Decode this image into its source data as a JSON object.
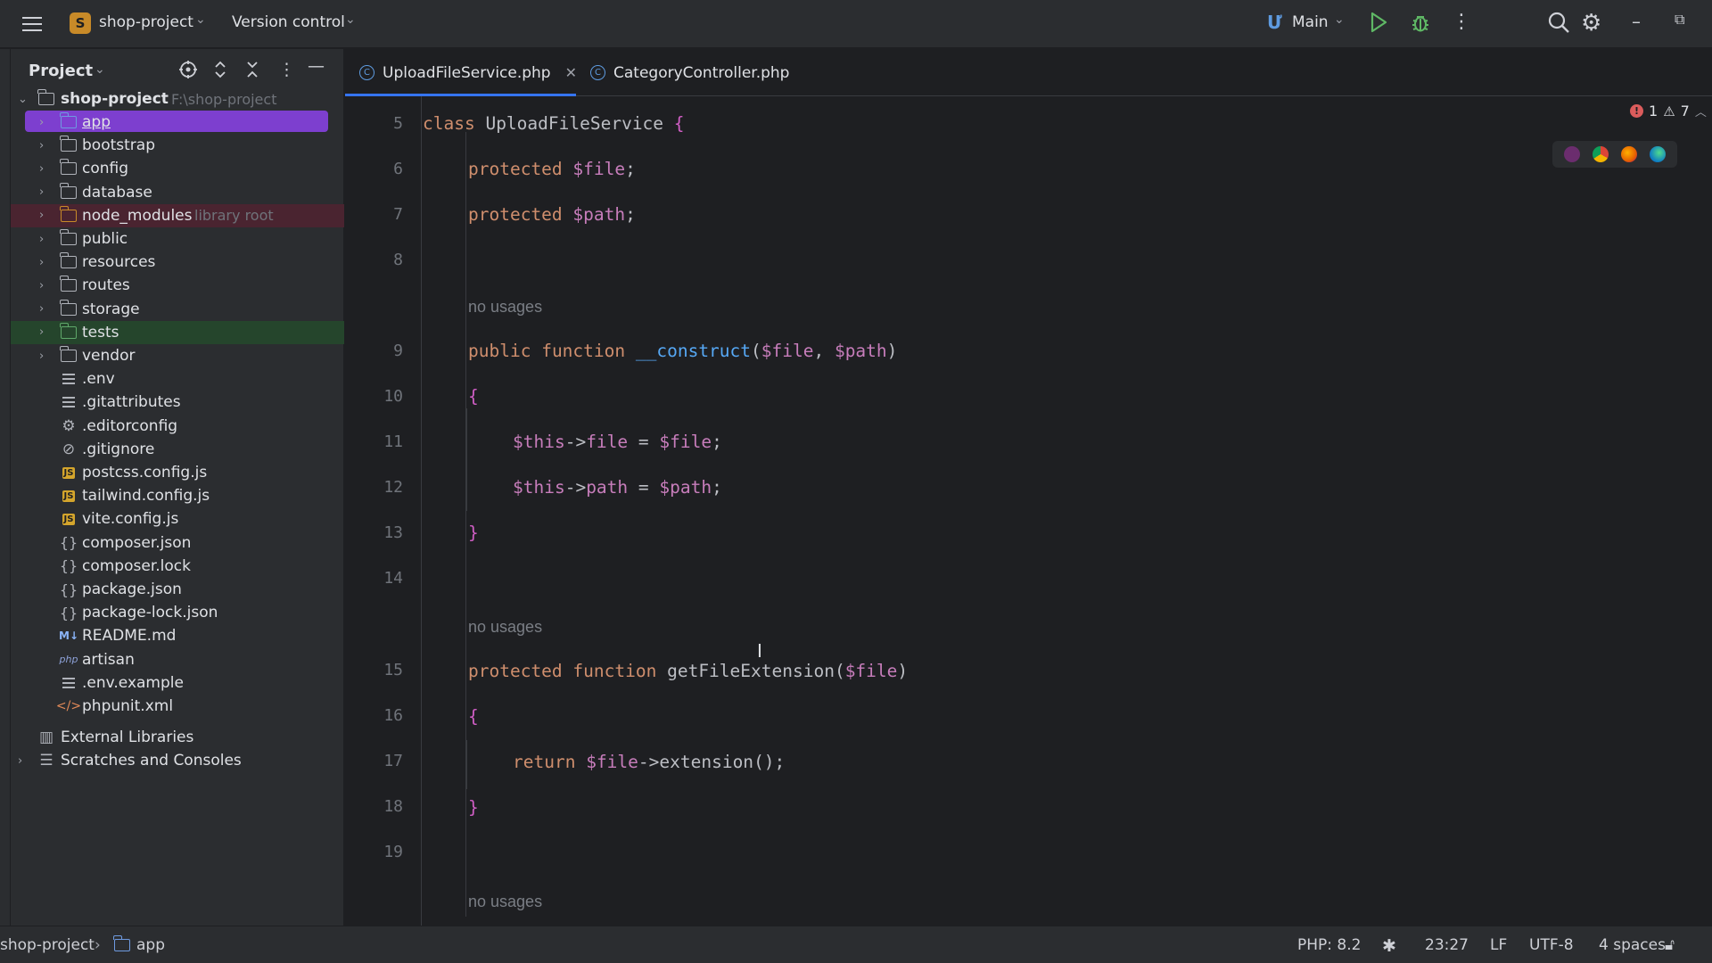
{
  "topbar": {
    "menu_icon": "hamburger-icon",
    "project_badge": "S",
    "project_name": "shop-project",
    "vcs_label": "Version control",
    "branch": "Main",
    "icons": [
      "run-icon",
      "debug-icon",
      "more-vertical-icon",
      "search-icon",
      "settings-icon",
      "minimize-icon",
      "restore-icon"
    ]
  },
  "project_panel": {
    "title": "Project",
    "root": {
      "name": "shop-project",
      "path": "F:\\shop-project"
    },
    "items": [
      {
        "label": "app",
        "type": "folder",
        "hint": ""
      },
      {
        "label": "bootstrap",
        "type": "folder",
        "hint": ""
      },
      {
        "label": "config",
        "type": "folder",
        "hint": ""
      },
      {
        "label": "database",
        "type": "folder",
        "hint": ""
      },
      {
        "label": "node_modules",
        "type": "folder",
        "hint": "library root"
      },
      {
        "label": "public",
        "type": "folder",
        "hint": ""
      },
      {
        "label": "resources",
        "type": "folder",
        "hint": ""
      },
      {
        "label": "routes",
        "type": "folder",
        "hint": ""
      },
      {
        "label": "storage",
        "type": "folder",
        "hint": ""
      },
      {
        "label": "tests",
        "type": "folder",
        "hint": ""
      },
      {
        "label": "vendor",
        "type": "folder",
        "hint": ""
      },
      {
        "label": ".env",
        "type": "text"
      },
      {
        "label": ".gitattributes",
        "type": "text"
      },
      {
        "label": ".editorconfig",
        "type": "gear"
      },
      {
        "label": ".gitignore",
        "type": "ignore"
      },
      {
        "label": "postcss.config.js",
        "type": "js"
      },
      {
        "label": "tailwind.config.js",
        "type": "js"
      },
      {
        "label": "vite.config.js",
        "type": "js"
      },
      {
        "label": "composer.json",
        "type": "json"
      },
      {
        "label": "composer.lock",
        "type": "json"
      },
      {
        "label": "package.json",
        "type": "json"
      },
      {
        "label": "package-lock.json",
        "type": "json"
      },
      {
        "label": "README.md",
        "type": "md"
      },
      {
        "label": "artisan",
        "type": "php"
      },
      {
        "label": ".env.example",
        "type": "text"
      },
      {
        "label": "phpunit.xml",
        "type": "xml"
      }
    ],
    "external_libraries": "External Libraries",
    "scratches": "Scratches and Consoles"
  },
  "tabs": [
    {
      "label": "UploadFileService.php",
      "active": true
    },
    {
      "label": "CategoryController.php",
      "active": false
    }
  ],
  "editor": {
    "line_numbers": [
      "5",
      "6",
      "7",
      "8",
      "9",
      "10",
      "11",
      "12",
      "13",
      "14",
      "15",
      "16",
      "17",
      "18",
      "19"
    ],
    "hint_no_usages": "no usages",
    "code": {
      "l5": [
        "class",
        "UploadFileService",
        "{"
      ],
      "l6": [
        "protected",
        "$file",
        ";"
      ],
      "l7": [
        "protected",
        "$path",
        ";"
      ],
      "l9": [
        "public",
        "function",
        "__construct",
        "(",
        "$file",
        ", ",
        "$path",
        ")"
      ],
      "l10": "{",
      "l11": [
        "$this",
        "->",
        "file",
        " = ",
        "$file",
        ";"
      ],
      "l12": [
        "$this",
        "->",
        "path",
        " = ",
        "$path",
        ";"
      ],
      "l13": "}",
      "l15": [
        "protected",
        "function",
        "getFileExtension",
        "(",
        "$file",
        ")"
      ],
      "l16": "{",
      "l17": [
        "return",
        "$file",
        "->",
        "extension",
        "();"
      ],
      "l18": "}"
    },
    "errors": "1",
    "warnings": "7"
  },
  "statusbar": {
    "breadcrumb_project": "shop-project",
    "breadcrumb_folder": "app",
    "php_version": "PHP: 8.2",
    "position": "23:27",
    "line_ending": "LF",
    "encoding": "UTF-8",
    "indent": "4 spaces"
  },
  "colors": {
    "selection": "#7d3fcf",
    "node_modules_bg": "#4a2430",
    "tests_bg": "#25452c",
    "accent": "#3574f0"
  }
}
